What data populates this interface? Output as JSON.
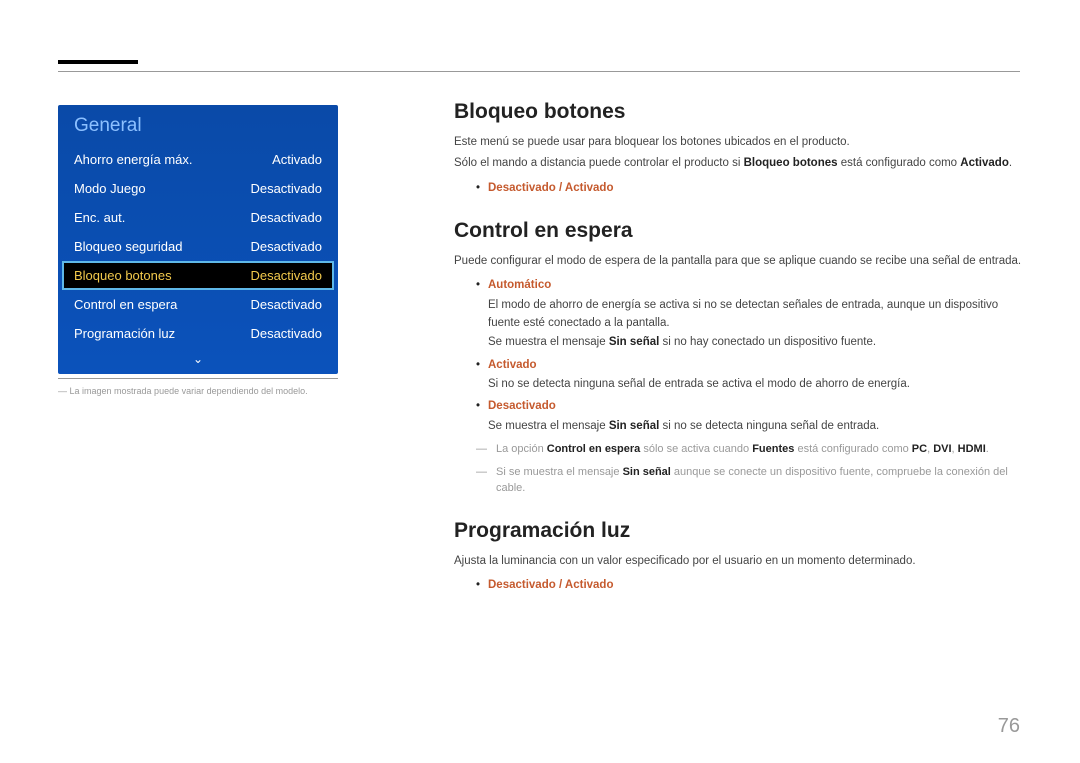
{
  "page_number": "76",
  "menu": {
    "title": "General",
    "rows": [
      {
        "label": "Ahorro energía máx.",
        "value": "Activado"
      },
      {
        "label": "Modo Juego",
        "value": "Desactivado"
      },
      {
        "label": "Enc. aut.",
        "value": "Desactivado"
      },
      {
        "label": "Bloqueo seguridad",
        "value": "Desactivado"
      },
      {
        "label": "Bloqueo botones",
        "value": "Desactivado",
        "selected": true
      },
      {
        "label": "Control en espera",
        "value": "Desactivado"
      },
      {
        "label": "Programación luz",
        "value": "Desactivado"
      }
    ],
    "scroll_glyph": "⌄"
  },
  "footnote": "La imagen mostrada puede variar dependiendo del modelo.",
  "sections": {
    "s1": {
      "title": "Bloqueo botones",
      "desc": "Este menú se puede usar para bloquear los botones ubicados en el producto.",
      "line2_pre": "Sólo el mando a distancia puede controlar el producto si ",
      "line2_bold": "Bloqueo botones",
      "line2_mid": " está configurado como ",
      "line2_bold2": "Activado",
      "line2_end": ".",
      "opt": "Desactivado / Activado"
    },
    "s2": {
      "title": "Control en espera",
      "desc": "Puede configurar el modo de espera de la pantalla para que se aplique cuando se recibe una señal de entrada.",
      "auto_label": "Automático",
      "auto_sub1": "El modo de ahorro de energía se activa si no se detectan señales de entrada, aunque un dispositivo fuente esté conectado a la pantalla.",
      "auto_sub2_pre": "Se muestra el mensaje ",
      "auto_sub2_bold": "Sin señal",
      "auto_sub2_post": " si no hay conectado un dispositivo fuente.",
      "act_label": "Activado",
      "act_sub": "Si no se detecta ninguna señal de entrada se activa el modo de ahorro de energía.",
      "des_label": "Desactivado",
      "des_sub_pre": "Se muestra el mensaje ",
      "des_sub_bold": "Sin señal",
      "des_sub_post": " si no se detecta ninguna señal de entrada.",
      "note1_pre": "La opción ",
      "note1_b1": "Control en espera",
      "note1_mid": " sólo se activa cuando ",
      "note1_b2": "Fuentes",
      "note1_mid2": " está configurado como ",
      "note1_b3": "PC",
      "note1_b4": "DVI",
      "note1_b5": "HDMI",
      "note1_end": ".",
      "note2_pre": "Si se muestra el mensaje ",
      "note2_b": "Sin señal",
      "note2_post": " aunque se conecte un dispositivo fuente, compruebe la conexión del cable."
    },
    "s3": {
      "title": "Programación luz",
      "desc": "Ajusta la luminancia con un valor especificado por el usuario en un momento determinado.",
      "opt": "Desactivado / Activado"
    }
  }
}
